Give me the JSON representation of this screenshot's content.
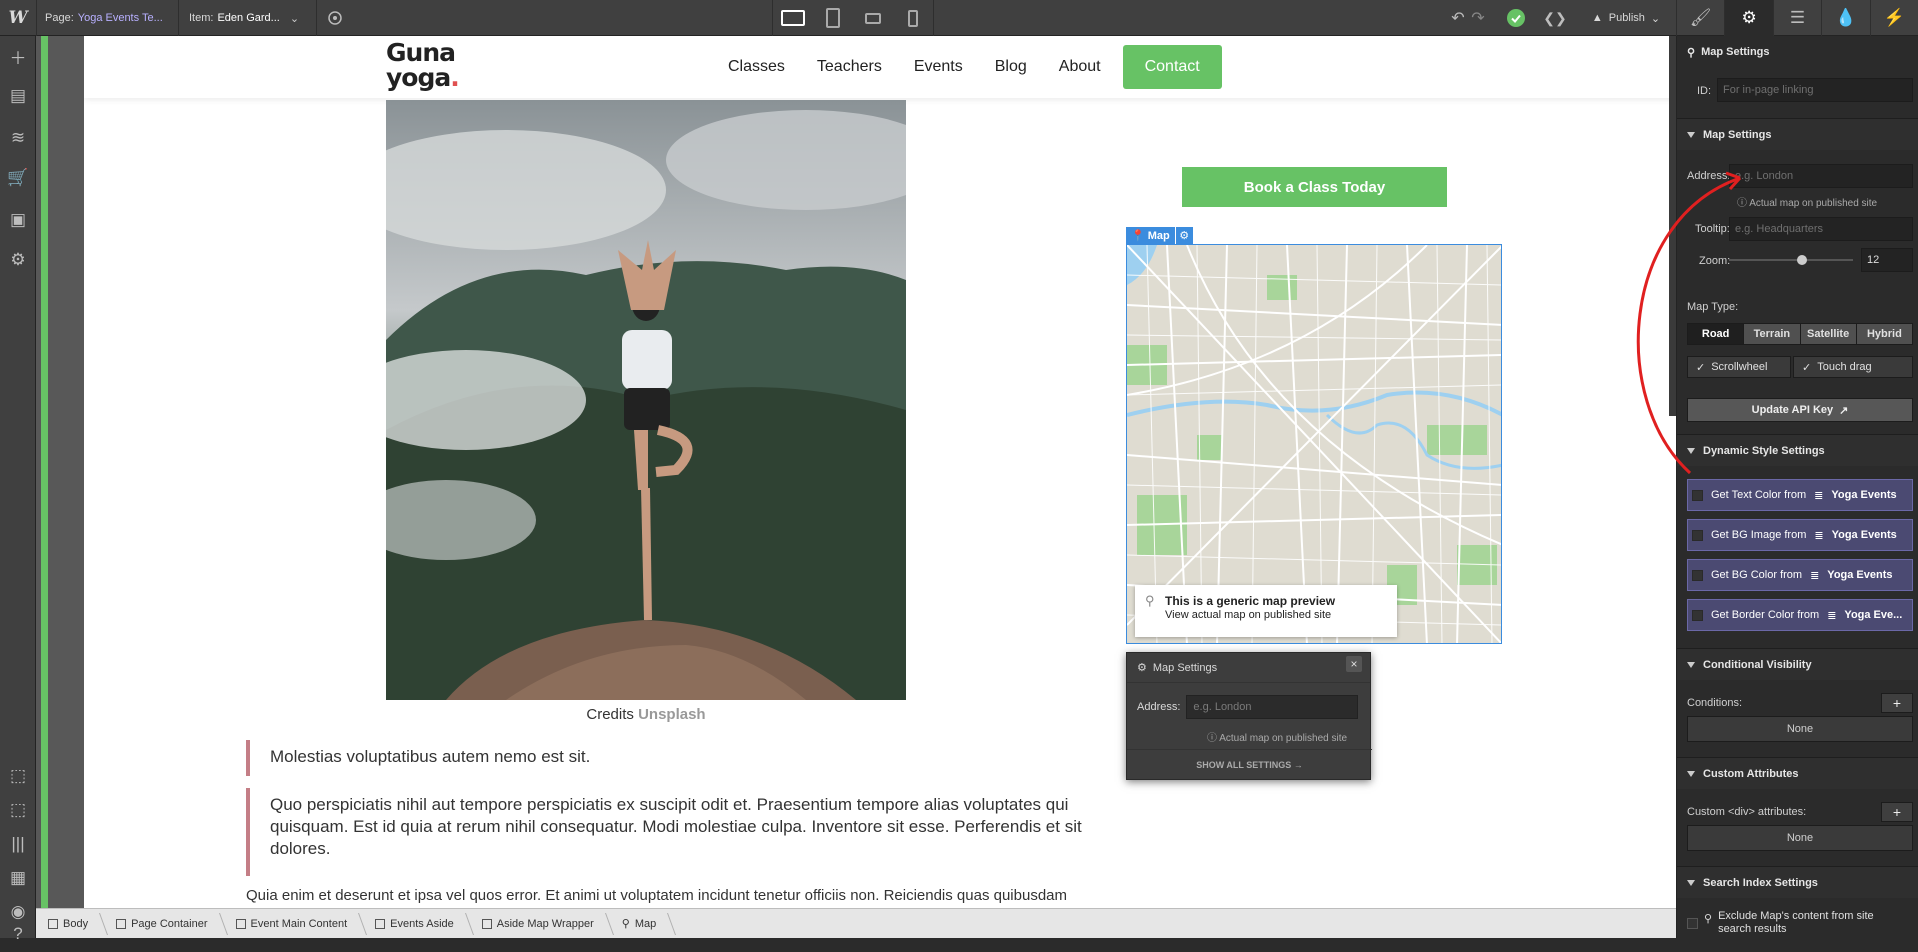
{
  "topbar": {
    "page_label": "Page:",
    "page_value": "Yoga Events Te...",
    "item_label": "Item:",
    "item_value": "Eden Gard...",
    "publish_label": "Publish"
  },
  "nav": {
    "logo_line1": "Guna",
    "logo_line2": "yoga",
    "logo_dot": ".",
    "links": [
      "Classes",
      "Teachers",
      "Events",
      "Blog",
      "About"
    ],
    "contact": "Contact"
  },
  "content": {
    "credits_prefix": "Credits",
    "credits_link": "Unsplash",
    "quote1": "Molestias voluptatibus autem nemo est sit.",
    "quote2": "Quo perspiciatis nihil aut tempore perspiciatis ex suscipit odit et. Praesentium tempore alias voluptates qui quisquam. Est id quia at rerum nihil consequatur. Modi molestiae culpa. Inventore sit esse. Perferendis et sit dolores.",
    "paragraph": "Quia enim et deserunt et ipsa vel quos error. Et animi ut voluptatem incidunt tenetur officiis non. Reiciendis quas quibusdam"
  },
  "aside": {
    "book_button": "Book a Class Today",
    "map_tag": "Map",
    "map_card_title": "This is a generic map preview",
    "map_card_sub": "View actual map on published site"
  },
  "popup": {
    "title": "Map Settings",
    "close": "×",
    "address_label": "Address:",
    "address_placeholder": "e.g. London",
    "note": "Actual map on published site",
    "show_all": "SHOW ALL SETTINGS →"
  },
  "breadcrumbs": [
    "Body",
    "Page Container",
    "Event Main Content",
    "Events Aside",
    "Aside Map Wrapper",
    "Map"
  ],
  "panel": {
    "element_title": "Map Settings",
    "id_label": "ID:",
    "id_placeholder": "For in-page linking",
    "section_map": "Map Settings",
    "address_label": "Address:",
    "address_placeholder": "e.g. London",
    "address_note": "Actual map on published site",
    "tooltip_label": "Tooltip:",
    "tooltip_placeholder": "e.g. Headquarters",
    "zoom_label": "Zoom:",
    "zoom_value": "12",
    "zoom_level_fraction": 0.6,
    "map_type_label": "Map Type:",
    "map_types": [
      "Road",
      "Terrain",
      "Satellite",
      "Hybrid"
    ],
    "map_type_selected": "Road",
    "scrollwheel": "Scrollwheel",
    "touch_drag": "Touch drag",
    "api_button": "Update API Key",
    "section_dynamic": "Dynamic Style Settings",
    "dynamic_items": [
      {
        "prefix": "Get Text Color from",
        "source": "Yoga Events"
      },
      {
        "prefix": "Get BG Image from",
        "source": "Yoga Events"
      },
      {
        "prefix": "Get BG Color from",
        "source": "Yoga Events"
      },
      {
        "prefix": "Get Border Color from",
        "source": "Yoga Eve..."
      }
    ],
    "section_visibility": "Conditional Visibility",
    "conditions_label": "Conditions:",
    "conditions_value": "None",
    "section_attributes": "Custom Attributes",
    "attributes_label": "Custom <div> attributes:",
    "attributes_value": "None",
    "section_search": "Search Index Settings",
    "exclude_label": "Exclude Map's content from site search results"
  },
  "colors": {
    "accent_green": "#67c265",
    "selection_blue": "#3b8cde",
    "dynamic_purple": "#4b4a72",
    "quote_border": "#c47e86",
    "annotation_red": "#e02020"
  }
}
